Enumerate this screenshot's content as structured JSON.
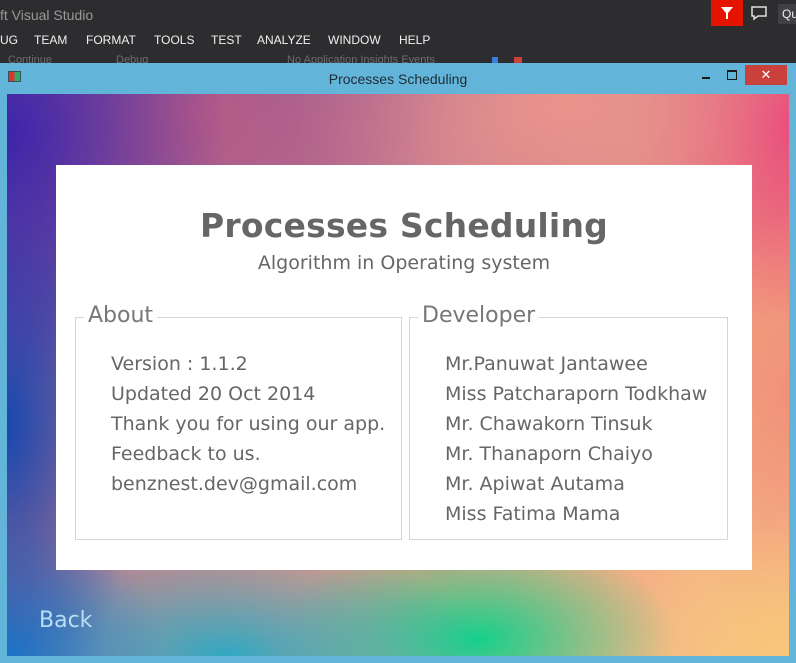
{
  "ide": {
    "title": "ft Visual Studio",
    "quick_launch": "Qu",
    "menu": [
      "UG",
      "TEAM",
      "FORMAT",
      "TOOLS",
      "TEST",
      "ANALYZE",
      "WINDOW",
      "HELP"
    ],
    "toolbar": {
      "continue_label": "Continue",
      "config_label": "Debug",
      "insights_label": "No Application Insights Events"
    }
  },
  "window": {
    "title": "Processes Scheduling",
    "close_glyph": "✕"
  },
  "card": {
    "title": "Processes Scheduling",
    "subtitle": "Algorithm in Operating system",
    "about": {
      "heading": "About",
      "lines": [
        "Version : 1.1.2",
        "Updated  20 Oct 2014",
        "Thank you for using our app.",
        "Feedback to us.",
        "benznest.dev@gmail.com"
      ]
    },
    "developer": {
      "heading": "Developer",
      "lines": [
        "Mr.Panuwat Jantawee",
        "Miss Patcharaporn Todkhaw",
        "Mr. Chawakorn Tinsuk",
        "Mr. Thanaporn Chaiyo",
        "Mr. Apiwat Autama",
        "Miss Fatima Mama"
      ]
    }
  },
  "back_label": "Back",
  "colors": {
    "window_frame": "#62b5d8",
    "close_button": "#c9413a",
    "text_gray": "#666666",
    "back_text": "#b8dff2"
  }
}
